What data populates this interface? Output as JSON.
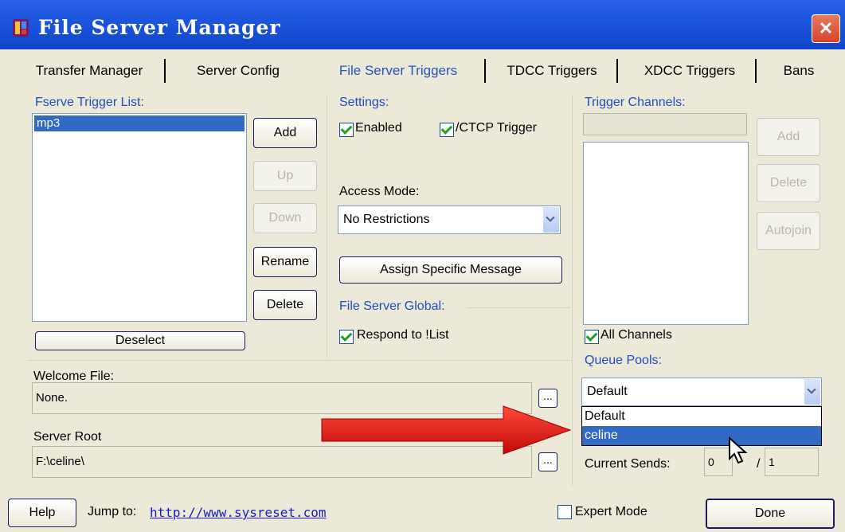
{
  "window": {
    "title": "File Server Manager",
    "close_glyph": "✕"
  },
  "tabs": [
    "Transfer Manager",
    "Server Config",
    "File Server Triggers",
    "TDCC Triggers",
    "XDCC Triggers",
    "Bans"
  ],
  "fserve": {
    "label": "Fserve Trigger List:",
    "items": [
      "mp3"
    ],
    "buttons": {
      "add": "Add",
      "up": "Up",
      "down": "Down",
      "rename": "Rename",
      "delete": "Delete",
      "deselect": "Deselect"
    }
  },
  "settings": {
    "label": "Settings:",
    "enabled": "Enabled",
    "ctcp": "/CTCP Trigger",
    "access_label": "Access Mode:",
    "access_value": "No Restrictions",
    "assign_button": "Assign Specific Message"
  },
  "global": {
    "label": "File Server Global:",
    "respond": "Respond to !List"
  },
  "channels": {
    "label": "Trigger Channels:",
    "add": "Add",
    "delete": "Delete",
    "autojoin": "Autojoin",
    "all_channels": "All Channels"
  },
  "queue": {
    "label": "Queue Pools:",
    "selected": "Default",
    "options": [
      "Default",
      "celine"
    ],
    "current_label": "Current Sends:",
    "current_value": "0",
    "max_value": "1",
    "slash": "/"
  },
  "welcome": {
    "label": "Welcome File:",
    "value": "None.",
    "browse": "..."
  },
  "server_root": {
    "label": "Server Root",
    "value": "F:\\celine\\",
    "browse": "..."
  },
  "bottom": {
    "help": "Help",
    "jump_label": "Jump to:",
    "jump_url": "http://www.sysreset.com",
    "expert": "Expert Mode",
    "done": "Done"
  },
  "colors": {
    "title_bar": "#1d56de",
    "selection": "#316ac5",
    "group_label": "#1f4ec0",
    "arrow": "#d81010"
  }
}
